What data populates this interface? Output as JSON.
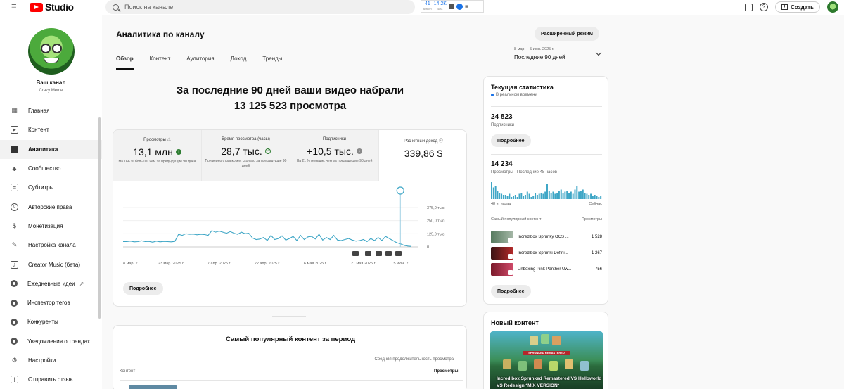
{
  "topbar": {
    "logo_text": "Studio",
    "search_placeholder": "Поиск на канале",
    "ext_count": "41",
    "ext_count_sub": "60мин",
    "ext_views": "14,2K",
    "ext_views_sub": "48ч.",
    "create_label": "Создать"
  },
  "channel": {
    "title": "Ваш канал",
    "name": "Crazy Meme"
  },
  "sidebar": {
    "items": [
      {
        "label": "Главная",
        "icon": "dashboard-icon"
      },
      {
        "label": "Контент",
        "icon": "content-icon"
      },
      {
        "label": "Аналитика",
        "icon": "analytics-icon"
      },
      {
        "label": "Сообщество",
        "icon": "community-icon"
      },
      {
        "label": "Субтитры",
        "icon": "subtitles-icon"
      },
      {
        "label": "Авторские права",
        "icon": "copyright-icon"
      },
      {
        "label": "Монетизация",
        "icon": "monetization-icon"
      },
      {
        "label": "Настройка канала",
        "icon": "customization-icon"
      },
      {
        "label": "Creator Music (бета)",
        "icon": "music-icon"
      },
      {
        "label": "Ежедневные идеи",
        "icon": "ideas-icon"
      },
      {
        "label": "Инспектор тегов",
        "icon": "tags-icon"
      },
      {
        "label": "Конкуренты",
        "icon": "competitors-icon"
      },
      {
        "label": "Уведомления о трендах",
        "icon": "trends-icon"
      },
      {
        "label": "Настройки",
        "icon": "settings-icon"
      },
      {
        "label": "Отправить отзыв",
        "icon": "feedback-icon"
      }
    ]
  },
  "header": {
    "title": "Аналитика по каналу",
    "advanced_mode": "Расширенный режим",
    "tabs": [
      "Обзор",
      "Контент",
      "Аудитория",
      "Доход",
      "Тренды"
    ],
    "range_dates": "8 мар. – 5 июн. 2025 г.",
    "range_label": "Последние 90 дней"
  },
  "summary": {
    "line1": "За последние 90 дней ваши видео набрали",
    "line2": "13 125 523 просмотра"
  },
  "metrics": [
    {
      "label": "Просмотры",
      "value": "13,1 млн",
      "note": "На 166 % больше, чем за предыдущие 90 дней"
    },
    {
      "label": "Время просмотра (часы)",
      "value": "28,7 тыс.",
      "note": "Примерно столько же, сколько за предыдущие 90 дней"
    },
    {
      "label": "Подписчики",
      "value": "+10,5 тыс.",
      "note": "На 21 % меньше, чем за предыдущие 90 дней"
    },
    {
      "label": "Расчетный доход",
      "value": "339,86 $",
      "note": ""
    }
  ],
  "chart_data": {
    "type": "line",
    "title": "",
    "y_ticks": [
      "375,0 тыс.",
      "250,0 тыс.",
      "125,0 тыс.",
      "0"
    ],
    "ylim": [
      0,
      375000
    ],
    "x_tick_labels": [
      "8 мар. 2...",
      "23 мар. 2025 г.",
      "7 апр. 2025 г.",
      "22 апр. 2025 г.",
      "6 мая 2025 г.",
      "21 мая 2025 г.",
      "5 июн. 2..."
    ],
    "series": [
      {
        "values": [
          50000,
          50000,
          55000,
          48000,
          50000,
          58000,
          50000,
          52000,
          45000,
          55000,
          48000,
          52000,
          50000,
          48000,
          52000,
          120000,
          110000,
          125000,
          120000,
          122000,
          115000,
          120000,
          118000,
          110000,
          155000,
          140000,
          150000,
          140000,
          130000,
          145000,
          130000,
          120000,
          140000,
          125000,
          130000,
          85000,
          70000,
          75000,
          90000,
          60000,
          110000,
          70000,
          80000,
          105000,
          65000,
          80000,
          100000,
          60000,
          110000,
          70000,
          95000,
          100000,
          75000,
          120000,
          65000,
          90000,
          70000,
          110000,
          65000,
          60000,
          70000,
          80000,
          65000,
          55000,
          60000,
          70000,
          50000,
          80000,
          60000,
          90000,
          60000,
          100000,
          80000,
          60000,
          40000,
          30000,
          15000,
          8000,
          5000
        ]
      }
    ]
  },
  "chart_more": "Подробнее",
  "top_content": {
    "title": "Самый популярный контент за период",
    "col_content": "Контент",
    "col_avg": "Средняя продолжительность просмотра",
    "col_views": "Просмотры"
  },
  "realtime": {
    "title": "Текущая статистика",
    "live": "В реальном времени",
    "subs_value": "24 823",
    "subs_label": "Подписчики",
    "more1": "Подробнее",
    "views_value": "14 234",
    "views_label": "Просмотры · Последние 48 часов",
    "axis_left": "48 ч. назад",
    "axis_right": "Сейчас",
    "bars": [
      80,
      55,
      60,
      40,
      30,
      25,
      20,
      20,
      15,
      25,
      10,
      15,
      20,
      10,
      25,
      30,
      15,
      20,
      35,
      25,
      10,
      15,
      30,
      20,
      25,
      30,
      25,
      35,
      70,
      40,
      30,
      35,
      25,
      30,
      40,
      45,
      30,
      35,
      40,
      30,
      35,
      25,
      45,
      60,
      35,
      40,
      45,
      30,
      25,
      20,
      25,
      15,
      20,
      15,
      10,
      15
    ],
    "top_label": "Самый популярный контент",
    "views_col": "Просмотры",
    "videos": [
      {
        "name": "Incredibox Sprunky OCS ...",
        "views": "1 528"
      },
      {
        "name": "Incredibox Sprunki Defini...",
        "views": "1 267"
      },
      {
        "name": "Unboxing Pink Panther Uw...",
        "views": "756"
      }
    ],
    "more2": "Подробнее"
  },
  "new_content": {
    "title": "Новый контент",
    "banner": "SPRUNKED REMASTERED",
    "caption": "Incredibox Sprunked Remastered VS Helloworld VS Redesign *MIX VERSION*"
  }
}
